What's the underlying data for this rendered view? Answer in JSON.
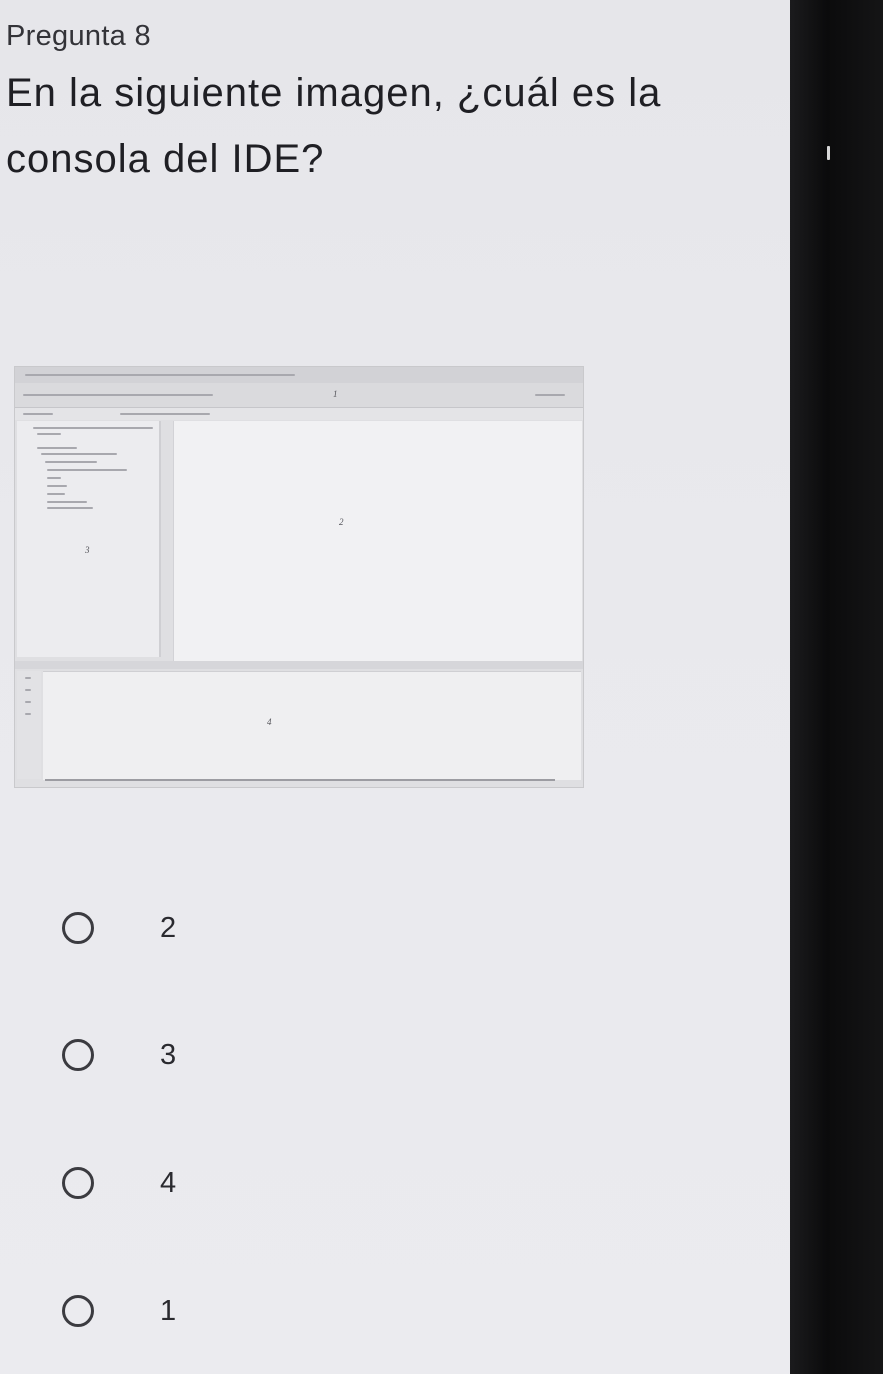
{
  "question": {
    "number": "Pregunta 8",
    "text": "En la siguiente imagen, ¿cuál es la consola del IDE?"
  },
  "ide_image": {
    "labels": [
      "1",
      "2",
      "3",
      "4"
    ]
  },
  "options": [
    {
      "label": "2"
    },
    {
      "label": "3"
    },
    {
      "label": "4"
    },
    {
      "label": "1"
    }
  ],
  "colors": {
    "background": "#e8e8ec",
    "text": "#1f1f24",
    "radio_border": "#3b3b40"
  }
}
